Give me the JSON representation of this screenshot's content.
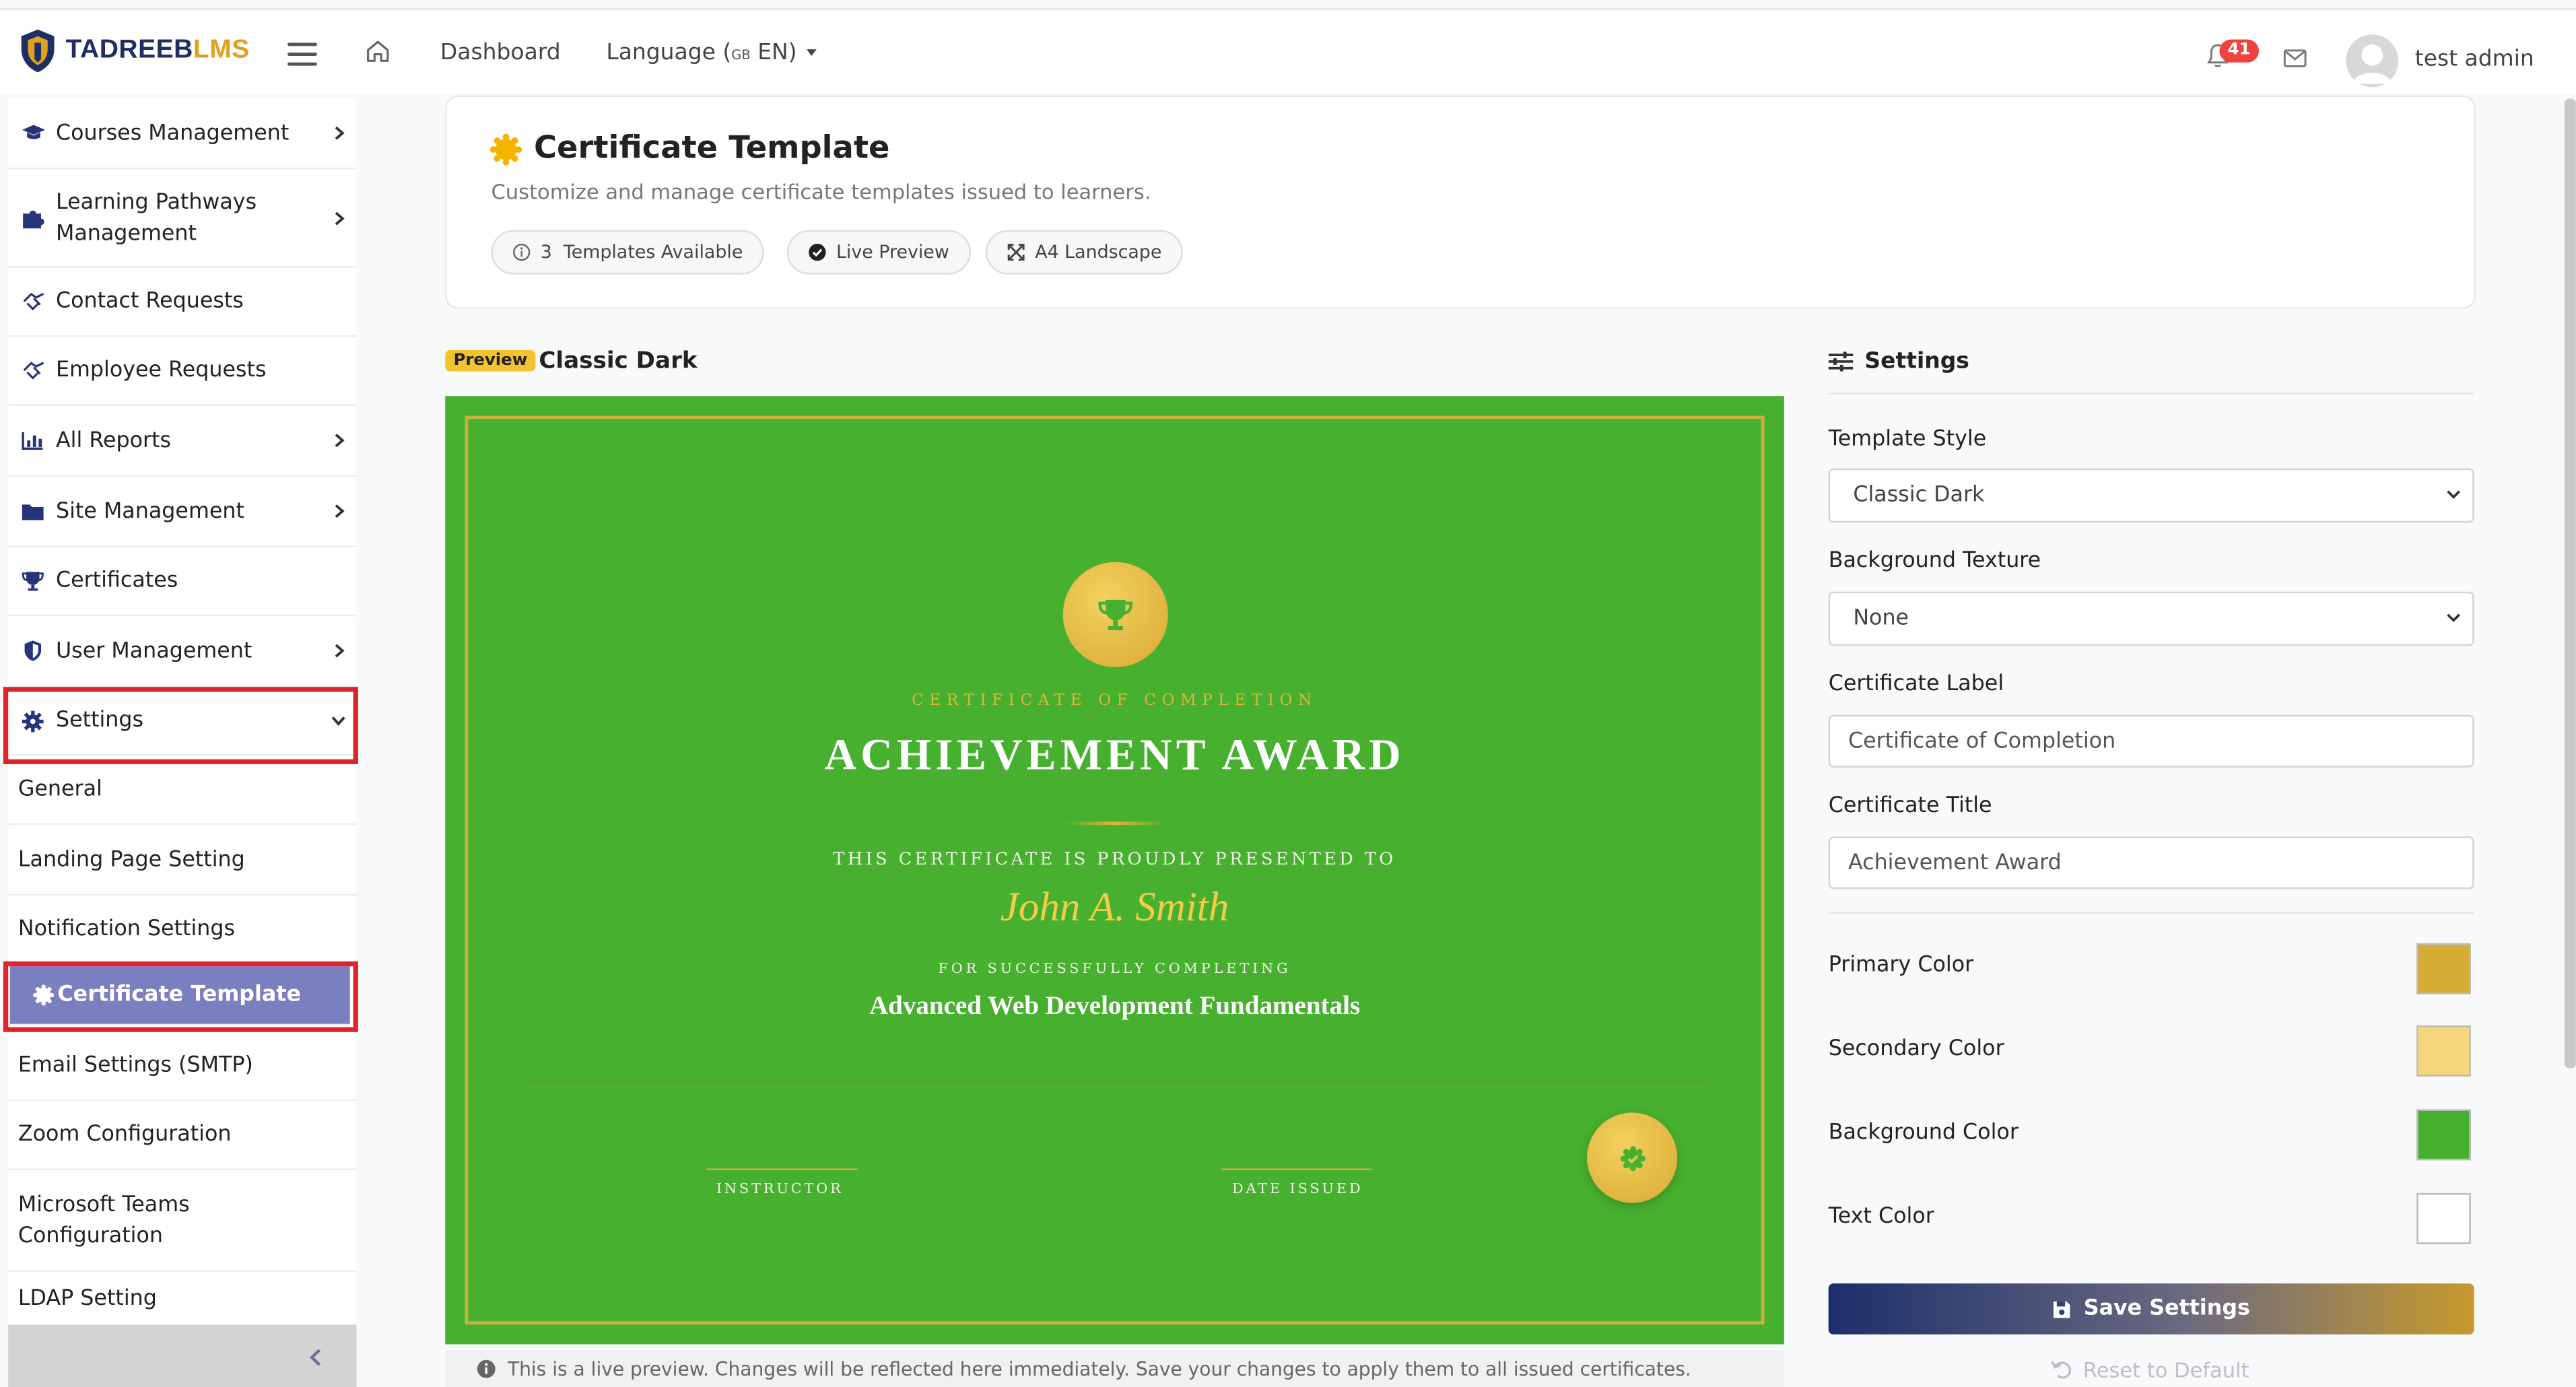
{
  "brand": {
    "name_primary": "TADREEB",
    "name_accent": "LMS",
    "icon": "shield-logo-icon"
  },
  "topbar": {
    "dashboard_label": "Dashboard",
    "language_label": "Language (",
    "language_flag": "GB",
    "language_code": " EN)",
    "notification_count": "41",
    "user_name": "test admin",
    "icons": [
      "hamburger-menu-icon",
      "home-icon",
      "bell-icon",
      "mail-icon",
      "avatar"
    ]
  },
  "sidebar": {
    "items": [
      {
        "label": "Courses Management",
        "icon": "graduation-cap-icon",
        "has_children": true
      },
      {
        "label": "Learning Pathways Management",
        "icon": "puzzle-icon",
        "has_children": true
      },
      {
        "label": "Contact Requests",
        "icon": "handshake-icon",
        "has_children": false
      },
      {
        "label": "Employee Requests",
        "icon": "handshake-icon",
        "has_children": false
      },
      {
        "label": "All Reports",
        "icon": "bar-chart-icon",
        "has_children": true
      },
      {
        "label": "Site Management",
        "icon": "folder-icon",
        "has_children": true
      },
      {
        "label": "Certificates",
        "icon": "trophy-icon",
        "has_children": false
      },
      {
        "label": "User Management",
        "icon": "shield-icon",
        "has_children": true
      },
      {
        "label": "Settings",
        "icon": "gear-icon",
        "expanded": true
      }
    ],
    "settings_children": [
      "General",
      "Landing Page Setting",
      "Notification Settings",
      "Certificate Template",
      "Email Settings (SMTP)",
      "Zoom Configuration",
      "Microsoft Teams Configuration",
      "LDAP Setting"
    ],
    "active_child": "Certificate Template",
    "highlight_color": "#e0242b"
  },
  "header": {
    "title": "Certificate Template",
    "subtitle": "Customize and manage certificate templates issued to learners.",
    "pills": [
      "3  Templates Available",
      "Live Preview",
      "A4 Landscape"
    ]
  },
  "preview": {
    "badge": "Preview",
    "template_name": "Classic Dark",
    "certificate": {
      "label": "CERTIFICATE OF COMPLETION",
      "title": "ACHIEVEMENT AWARD",
      "presented_to": "THIS CERTIFICATE IS PROUDLY PRESENTED TO",
      "recipient": "John A. Smith",
      "for_completing": "FOR SUCCESSFULLY COMPLETING",
      "course": "Advanced Web Development Fundamentals",
      "instructor_label": "INSTRUCTOR",
      "date_label": "DATE ISSUED"
    },
    "note": "This is a live preview. Changes will be reflected here immediately. Save your changes to apply them to all issued certificates."
  },
  "settings": {
    "heading": "Settings",
    "template_style_label": "Template Style",
    "template_style_value": "Classic Dark",
    "background_texture_label": "Background Texture",
    "background_texture_value": "None",
    "certificate_label_label": "Certificate Label",
    "certificate_label_value": "Certificate of Completion",
    "certificate_title_label": "Certificate Title",
    "certificate_title_value": "Achievement Award",
    "primary_color_label": "Primary Color",
    "secondary_color_label": "Secondary Color",
    "background_color_label": "Background Color",
    "text_color_label": "Text Color",
    "save_label": "Save Settings",
    "reset_label": "Reset to Default"
  },
  "colors": {
    "primary": "#d6ac35",
    "secondary": "#f5d67a",
    "background": "#47b02e",
    "text": "#ffffff",
    "brand_navy": "#1f2f63",
    "brand_gold": "#e0a020"
  }
}
